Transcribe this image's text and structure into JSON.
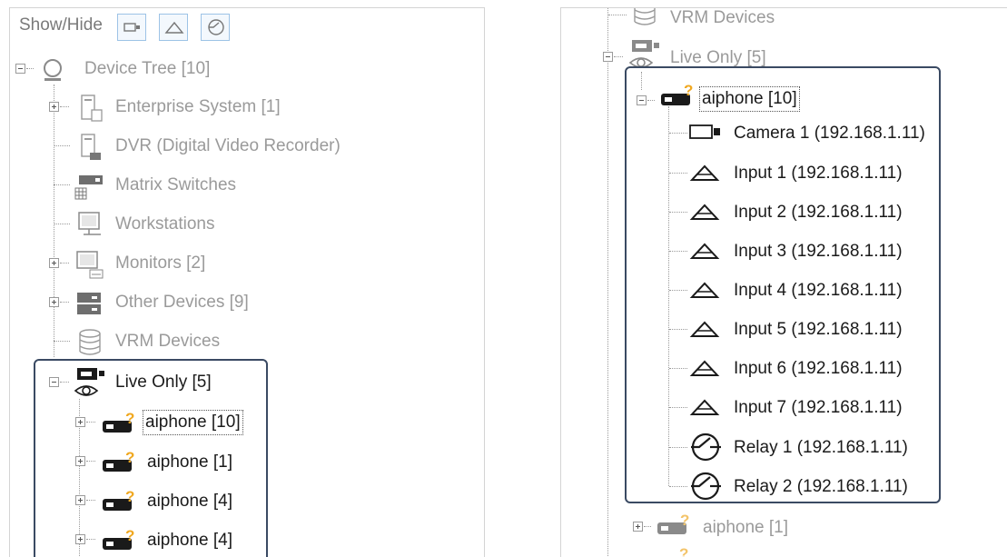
{
  "toolbar": {
    "show_hide_label": "Show/Hide"
  },
  "left_tree": {
    "root": "Device Tree [10]",
    "items": [
      "Enterprise System [1]",
      "DVR (Digital Video Recorder)",
      "Matrix Switches",
      "Workstations",
      "Monitors [2]",
      "Other Devices [9]",
      "VRM Devices",
      "Live Only [5]"
    ],
    "aiphone_items": [
      "aiphone [10]",
      "aiphone [1]",
      "aiphone [4]",
      "aiphone [4]"
    ]
  },
  "right_tree": {
    "vrm": "VRM Devices",
    "live_only": "Live Only [5]",
    "selected": "aiphone [10]",
    "children": [
      "Camera 1 (192.168.1.11)",
      "Input 1 (192.168.1.11)",
      "Input 2 (192.168.1.11)",
      "Input 3 (192.168.1.11)",
      "Input 4 (192.168.1.11)",
      "Input 5 (192.168.1.11)",
      "Input 6 (192.168.1.11)",
      "Input 7 (192.168.1.11)",
      "Relay 1 (192.168.1.11)",
      "Relay 2 (192.168.1.11)"
    ],
    "after": "aiphone [1]"
  },
  "colors": {
    "highlight_border": "#3a4a63",
    "dim_text": "#9a9a9a",
    "badge": "#f0a820"
  }
}
